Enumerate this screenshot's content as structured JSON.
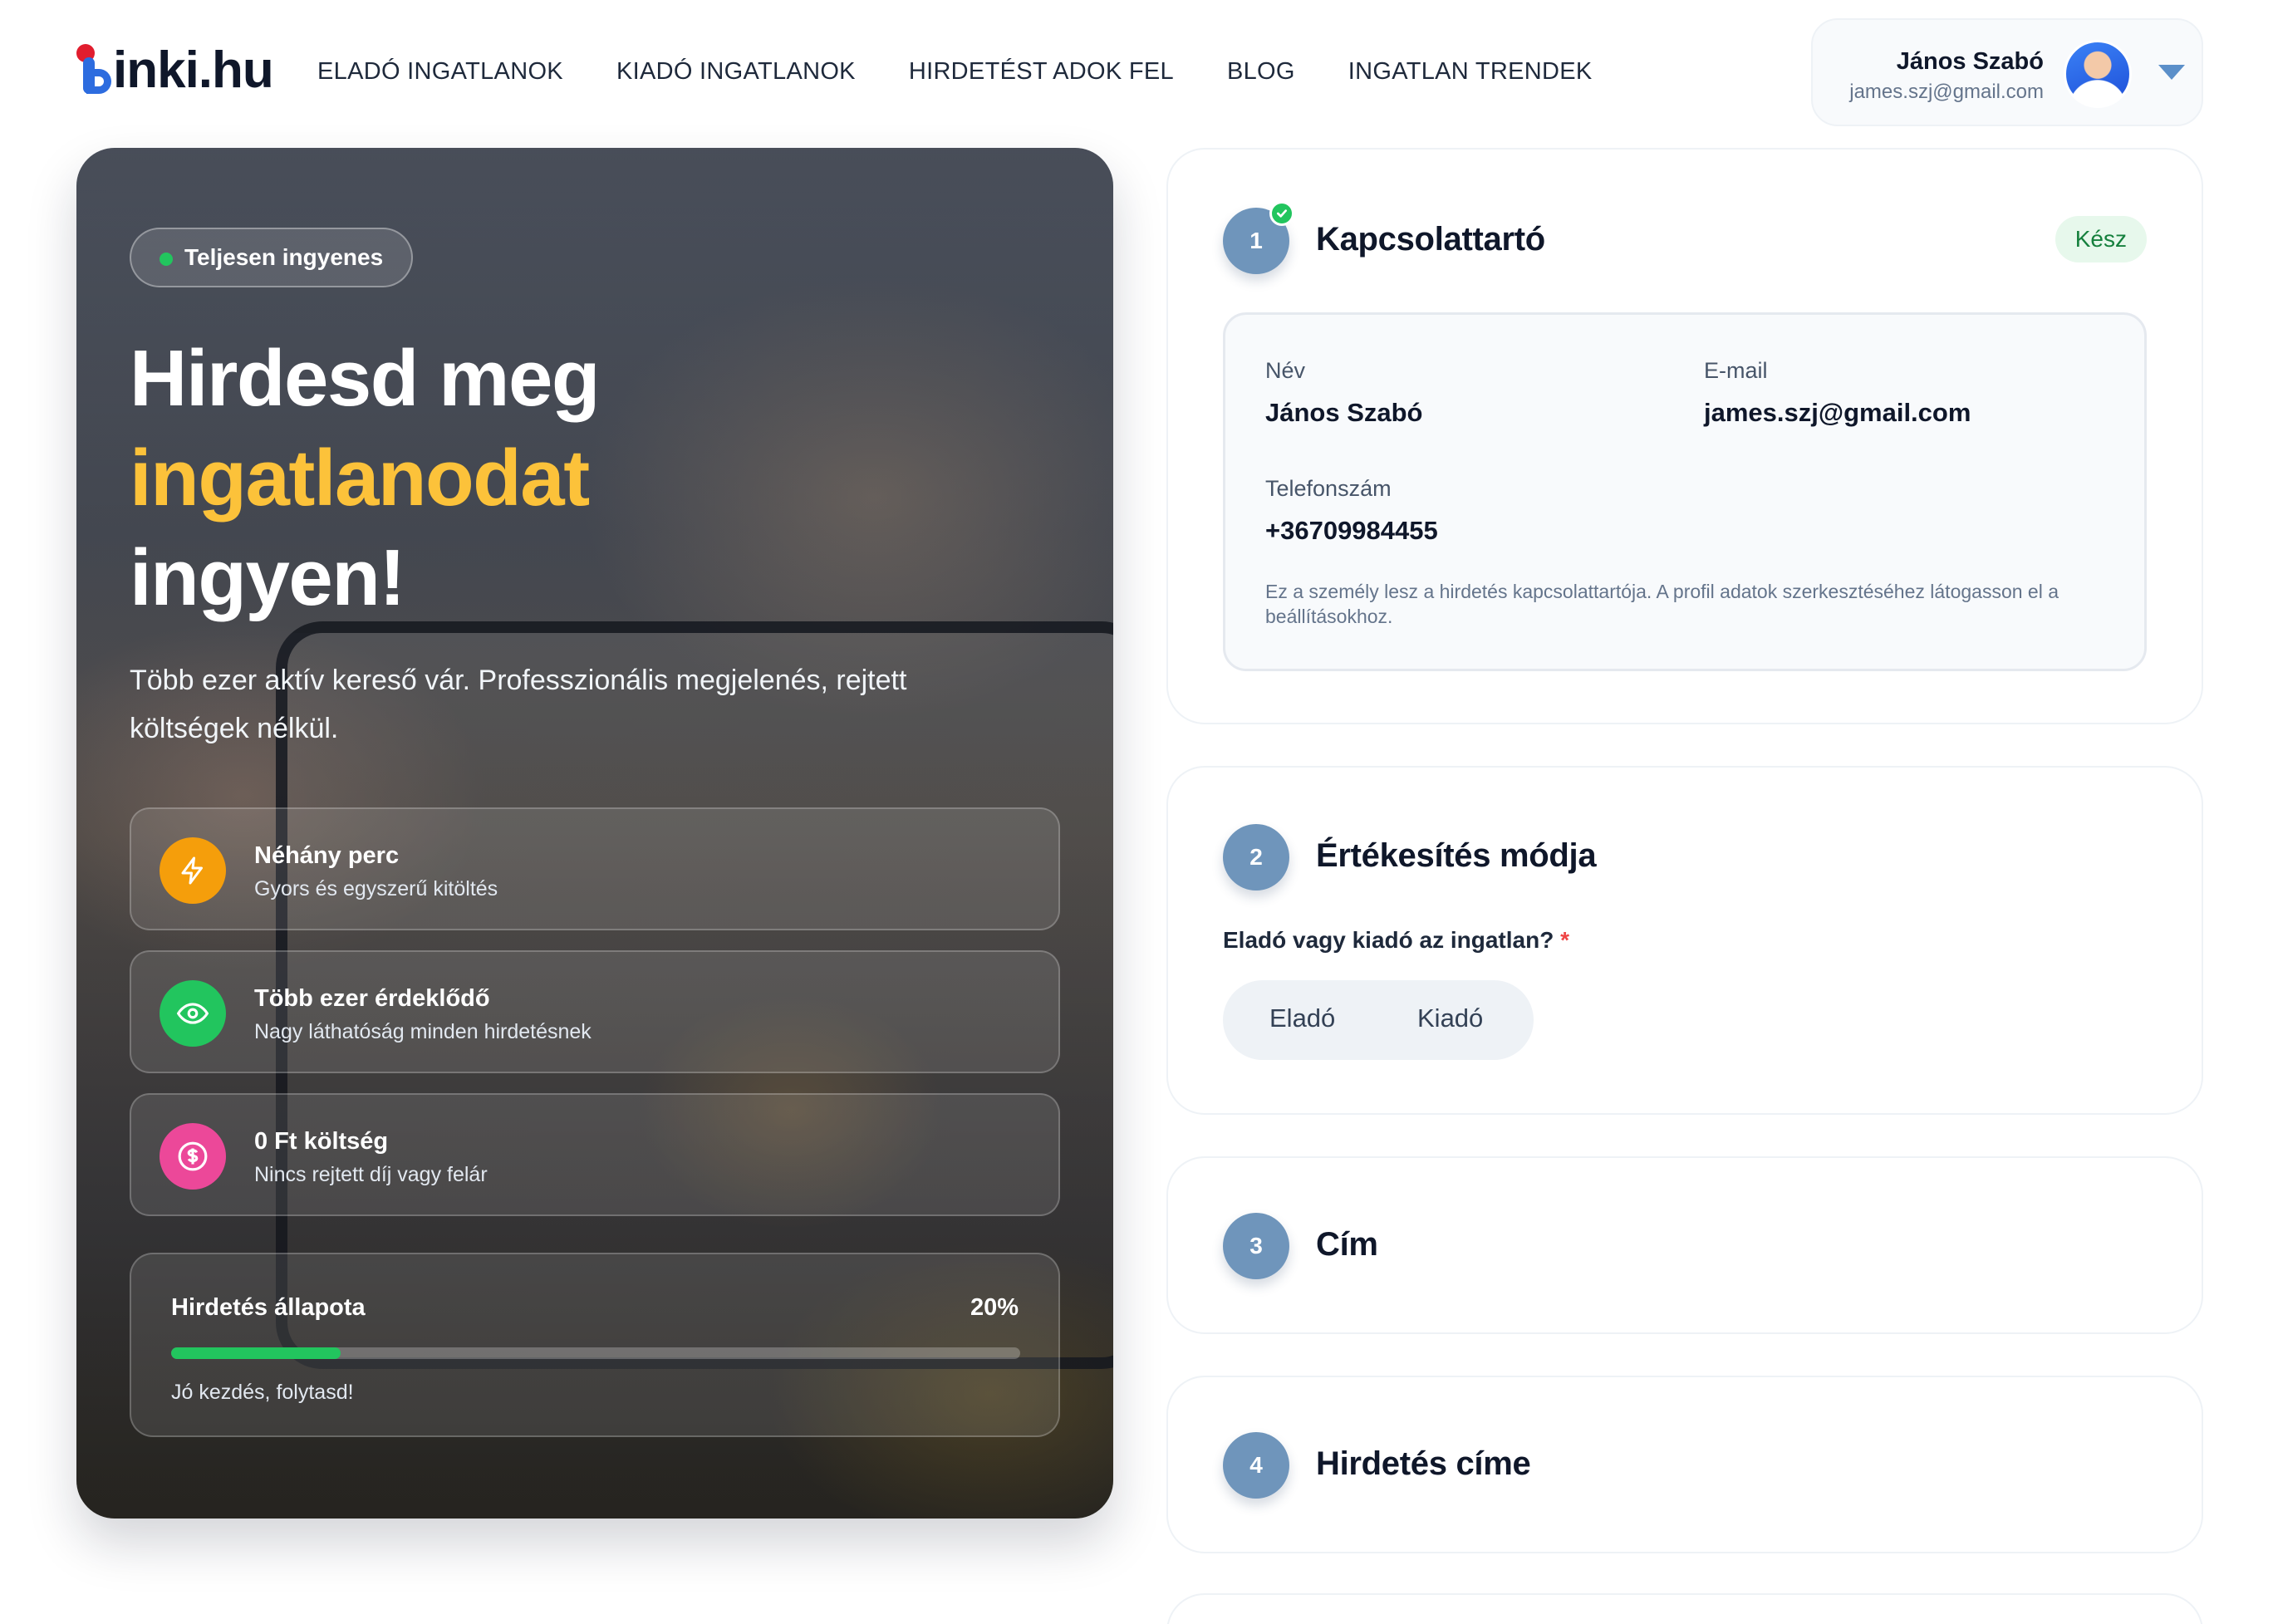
{
  "header": {
    "logo_text": "inki.hu",
    "nav": [
      {
        "label": "ELADÓ INGATLANOK"
      },
      {
        "label": "KIADÓ INGATLANOK"
      },
      {
        "label": "HIRDETÉST ADOK FEL"
      },
      {
        "label": "BLOG"
      },
      {
        "label": "INGATLAN TRENDEK"
      }
    ],
    "user": {
      "name": "János Szabó",
      "email": "james.szj@gmail.com"
    }
  },
  "hero": {
    "badge": "Teljesen ingyenes",
    "headline_line1": "Hirdesd meg",
    "headline_accent": "ingatlanodat",
    "headline_line3": "ingyen!",
    "subtitle": "Több ezer aktív kereső vár. Professzionális megjelenés, rejtett költségek nélkül.",
    "features": [
      {
        "title": "Néhány perc",
        "desc": "Gyors és egyszerű kitöltés",
        "icon": "lightning-icon",
        "color": "#f59e0b"
      },
      {
        "title": "Több ezer érdeklődő",
        "desc": "Nagy láthatóság minden hirdetésnek",
        "icon": "eye-icon",
        "color": "#22c55e"
      },
      {
        "title": "0 Ft költség",
        "desc": "Nincs rejtett díj vagy felár",
        "icon": "dollar-icon",
        "color": "#ec4899"
      }
    ],
    "status": {
      "title": "Hirdetés állapota",
      "percent_label": "20%",
      "progress": 0.2,
      "note": "Jó kezdés, folytasd!"
    }
  },
  "steps": [
    {
      "number": "1",
      "title": "Kapcsolattartó",
      "badge": "Kész",
      "contact": {
        "name_label": "Név",
        "name_value": "János Szabó",
        "email_label": "E-mail",
        "email_value": "james.szj@gmail.com",
        "phone_label": "Telefonszám",
        "phone_value": "+36709984455",
        "note": "Ez a személy lesz a hirdetés kapcsolattartója. A profil adatok szerkesztéséhez látogasson el a beállításokhoz."
      }
    },
    {
      "number": "2",
      "title": "Értékesítés módja",
      "question": "Eladó vagy kiadó az ingatlan?",
      "required_mark": "*",
      "options": [
        "Eladó",
        "Kiadó"
      ]
    },
    {
      "number": "3",
      "title": "Cím"
    },
    {
      "number": "4",
      "title": "Hirdetés címe"
    }
  ],
  "colors": {
    "accent_yellow": "#fcc23a",
    "step_blue": "#6f95bb",
    "success_green": "#22c55e"
  }
}
